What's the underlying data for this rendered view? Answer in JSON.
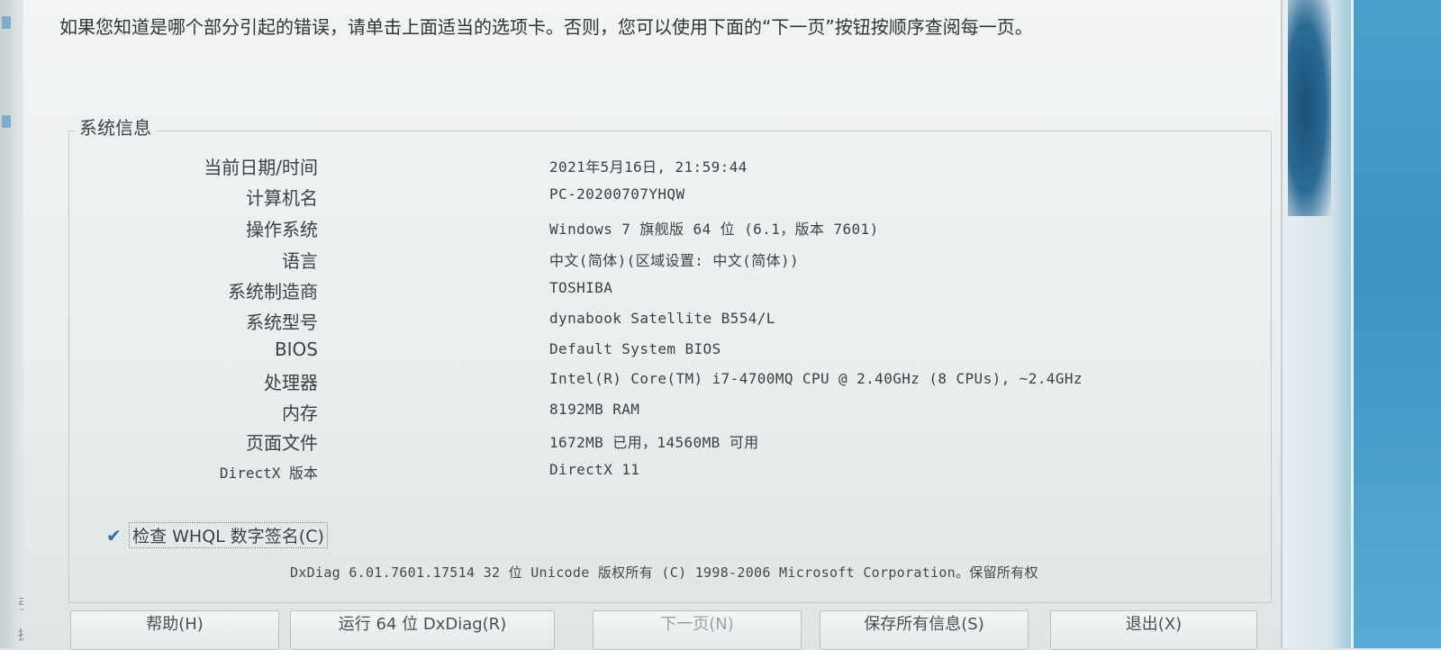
{
  "instruction": "如果您知道是哪个部分引起的错误，请单击上面适当的选项卡。否则，您可以使用下面的“下一页”按钮按顺序查阅每一页。",
  "system_info": {
    "title": "系统信息",
    "rows": [
      {
        "label": "当前日期/时间",
        "value": "2021年5月16日, 21:59:44"
      },
      {
        "label": "计算机名",
        "value": "PC-20200707YHQW"
      },
      {
        "label": "操作系统",
        "value": "Windows 7 旗舰版 64 位 (6.1，版本 7601)"
      },
      {
        "label": "语言",
        "value": "中文(简体)(区域设置: 中文(简体))"
      },
      {
        "label": "系统制造商",
        "value": "TOSHIBA"
      },
      {
        "label": "系统型号",
        "value": "dynabook Satellite B554/L"
      },
      {
        "label": "BIOS",
        "value": "Default System BIOS"
      },
      {
        "label": "处理器",
        "value": "Intel(R) Core(TM) i7-4700MQ CPU @ 2.40GHz (8 CPUs), ~2.4GHz"
      },
      {
        "label": "内存",
        "value": "8192MB RAM"
      },
      {
        "label": "页面文件",
        "value": "1672MB 已用，14560MB 可用"
      },
      {
        "label": "DirectX 版本",
        "value": "DirectX 11"
      }
    ]
  },
  "whql_checkbox": {
    "label": "检查 WHQL 数字签名(C)",
    "checked": true
  },
  "footer": "DxDiag 6.01.7601.17514 32 位 Unicode 版权所有 (C) 1998-2006 Microsoft Corporation。保留所有权",
  "buttons": {
    "help": "帮助(H)",
    "run64": "运行 64 位 DxDiag(R)",
    "next": "下一页(N)",
    "save": "保存所有信息(S)",
    "exit": "退出(X)"
  },
  "left_edge_glyphs": [
    "引",
    "提"
  ],
  "colors": {
    "dialog_bg": "#eef1f1",
    "accent_blue": "#2f6ea2",
    "side_blue": "#3d93c2"
  },
  "icons": {
    "checkbox": "check-icon"
  }
}
